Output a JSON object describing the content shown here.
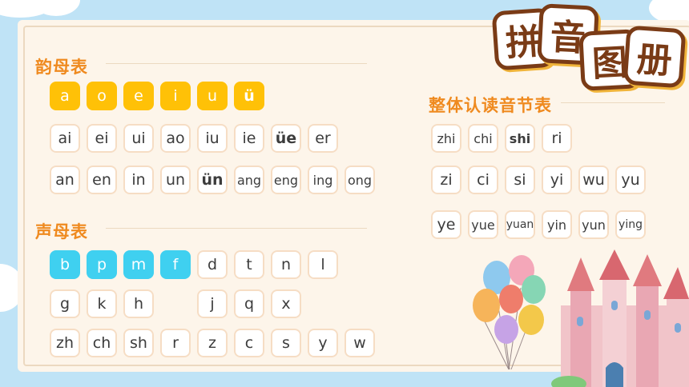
{
  "title_chars": [
    "拼",
    "音",
    "图",
    "册"
  ],
  "finals": {
    "title": "韵母表",
    "row1": [
      "a",
      "o",
      "e",
      "i",
      "u",
      "ü"
    ],
    "row2": [
      "ai",
      "ei",
      "ui",
      "ao",
      "iu",
      "ie",
      "üe",
      "er"
    ],
    "row3": [
      "an",
      "en",
      "in",
      "un",
      "ün",
      "ang",
      "eng",
      "ing",
      "ong"
    ]
  },
  "initials": {
    "title": "声母表",
    "row1": [
      "b",
      "p",
      "m",
      "f",
      "d",
      "t",
      "n",
      "l"
    ],
    "row2": [
      "g",
      "k",
      "h",
      "j",
      "q",
      "x"
    ],
    "row3": [
      "zh",
      "ch",
      "sh",
      "r",
      "z",
      "c",
      "s",
      "y",
      "w"
    ]
  },
  "whole": {
    "title": "整体认读音节表",
    "row1": [
      "zhi",
      "chi",
      "shi",
      "ri"
    ],
    "row2": [
      "zi",
      "ci",
      "si",
      "yi",
      "wu",
      "yu"
    ],
    "row3": [
      "ye",
      "yue",
      "yuan",
      "yin",
      "yun",
      "ying"
    ]
  },
  "colors": {
    "vowel_highlight": "#ffc107",
    "initial_highlight": "#3fd0f0",
    "title": "#ef8a1f"
  }
}
